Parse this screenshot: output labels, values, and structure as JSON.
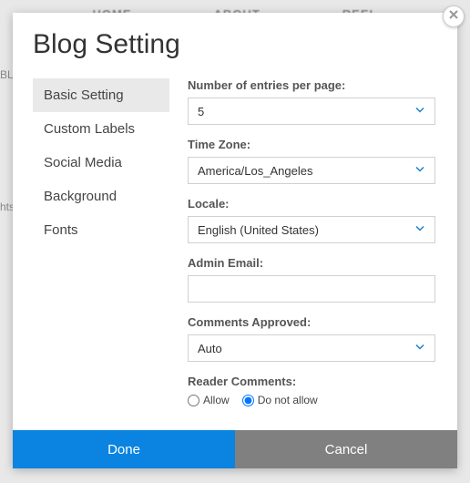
{
  "background": {
    "nav": [
      "HOME",
      "ABOUT",
      "REEL"
    ],
    "left1": "BLO",
    "left2": "hts"
  },
  "modal": {
    "title": "Blog Setting",
    "close": "×"
  },
  "sidebar": {
    "items": [
      {
        "label": "Basic Setting",
        "active": true
      },
      {
        "label": "Custom Labels",
        "active": false
      },
      {
        "label": "Social Media",
        "active": false
      },
      {
        "label": "Background",
        "active": false
      },
      {
        "label": "Fonts",
        "active": false
      }
    ]
  },
  "fields": {
    "entries": {
      "label": "Number of entries per page:",
      "value": "5"
    },
    "timezone": {
      "label": "Time Zone:",
      "value": "America/Los_Angeles"
    },
    "locale": {
      "label": "Locale:",
      "value": "English (United States)"
    },
    "email": {
      "label": "Admin Email:",
      "value": ""
    },
    "comments_approved": {
      "label": "Comments Approved:",
      "value": "Auto"
    },
    "reader_comments": {
      "label": "Reader Comments:",
      "options": [
        {
          "label": "Allow",
          "checked": false
        },
        {
          "label": "Do not allow",
          "checked": true
        }
      ]
    }
  },
  "footer": {
    "done": "Done",
    "cancel": "Cancel"
  },
  "colors": {
    "primary": "#0a84e0",
    "chevron": "#1e7fc9"
  }
}
